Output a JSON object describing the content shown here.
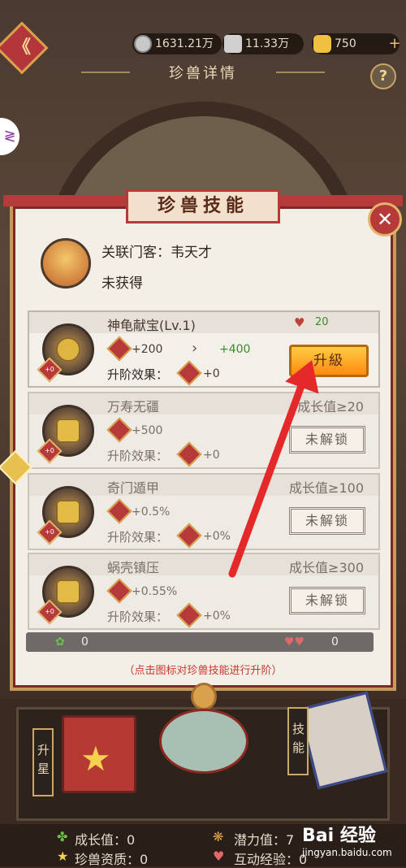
{
  "header": {
    "back_glyph": "《",
    "resources": [
      {
        "name": "copper-coin",
        "value": "1631.21万"
      },
      {
        "name": "feather",
        "value": "11.33万"
      },
      {
        "name": "gold-ingot",
        "value": "750"
      }
    ],
    "plus_label": "+",
    "title": "珍兽详情",
    "help_glyph": "?"
  },
  "panel": {
    "title": "珍兽技能",
    "close_glyph": "✕",
    "related_label": "关联门客：",
    "related_name": "韦天才",
    "status": "未获得"
  },
  "skills": [
    {
      "name": "神龟献宝(Lv.1)",
      "heart_value": "20",
      "stat_value": "+200",
      "next_value": "+400",
      "upgrade_label": "升阶效果：",
      "upgrade_value": "+0",
      "button": "升級",
      "badge": "+0"
    },
    {
      "name": "万寿无疆",
      "requirement": "成长值≥20",
      "stat_value": "+500",
      "upgrade_label": "升阶效果：",
      "upgrade_value": "+0",
      "button": "未解锁",
      "badge": "+0"
    },
    {
      "name": "奇门遁甲",
      "requirement": "成长值≥100",
      "stat_value": "+0.5%",
      "upgrade_label": "升阶效果：",
      "upgrade_value": "+0%",
      "button": "未解锁",
      "badge": "+0"
    },
    {
      "name": "蜗壳镇压",
      "requirement": "成长值≥300",
      "stat_value": "+0.55%",
      "upgrade_label": "升阶效果：",
      "upgrade_value": "+0%",
      "button": "未解锁",
      "badge": "+0"
    }
  ],
  "bottom_bar": {
    "left_value": "0",
    "right_value": "0"
  },
  "hint": "（点击图标对珍兽技能进行升阶）",
  "lower": {
    "left_tag": "升星",
    "right_tag": "技能"
  },
  "stats": {
    "growth": "成长值：0",
    "potential": "潜力值：7",
    "quality": "珍兽资质：0",
    "interaction": "互动经验：0"
  },
  "watermark": {
    "brand": "Bai 经验",
    "url": "jingyan.baidu.com"
  },
  "colors": {
    "accent_red": "#b73a3a",
    "button_orange": "#ff8a10",
    "green_value": "#3a8a2a"
  }
}
